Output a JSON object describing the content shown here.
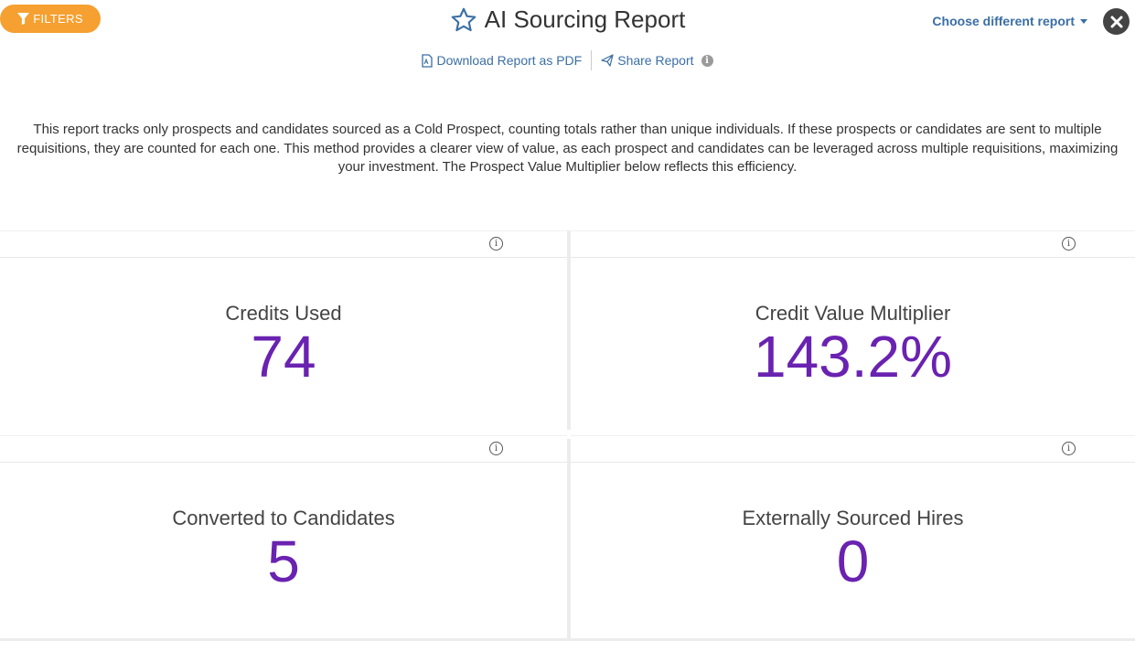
{
  "toolbar": {
    "filters_label": "FILTERS",
    "title": "AI Sourcing Report",
    "choose_label": "Choose different report",
    "download_label": "Download Report as PDF",
    "share_label": "Share Report"
  },
  "description": "This report tracks only prospects and candidates sourced as a Cold Prospect, counting totals rather than unique individuals. If these prospects or candidates are sent to multiple requisitions, they are counted for each one. This method provides a clearer view of value, as each prospect and candidates can be leveraged across multiple requisitions, maximizing your investment. The Prospect Value Multiplier below reflects this efficiency.",
  "metrics": [
    {
      "label": "Credits Used",
      "value": "74"
    },
    {
      "label": "Credit Value Multiplier",
      "value": "143.2%"
    },
    {
      "label": "Converted to Candidates",
      "value": "5"
    },
    {
      "label": "Externally Sourced Hires",
      "value": "0"
    }
  ],
  "colors": {
    "accent_orange": "#f5a031",
    "link_blue": "#3a6ea5",
    "metric_purple": "#6a22b1"
  }
}
